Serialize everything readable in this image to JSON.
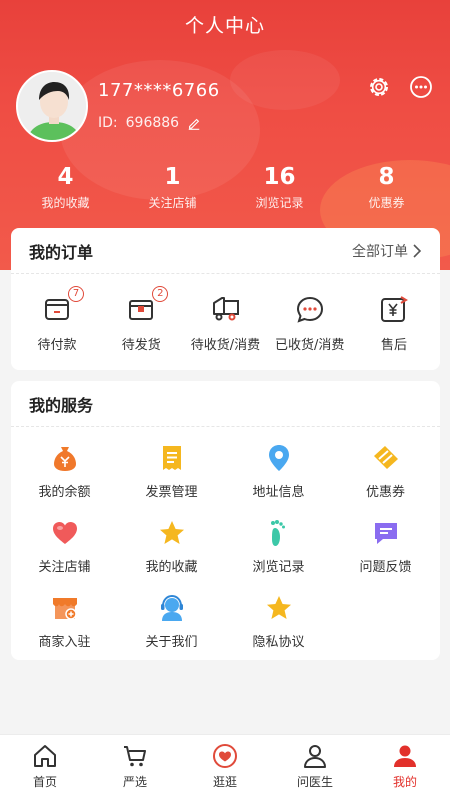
{
  "header": {
    "title": "个人中心"
  },
  "profile": {
    "phone": "177****6766",
    "id_label": "ID:",
    "id_value": "696886"
  },
  "stats": [
    {
      "value": "4",
      "label": "我的收藏"
    },
    {
      "value": "1",
      "label": "关注店铺"
    },
    {
      "value": "16",
      "label": "浏览记录"
    },
    {
      "value": "8",
      "label": "优惠券"
    }
  ],
  "orders": {
    "title": "我的订单",
    "all_link": "全部订单",
    "items": [
      {
        "label": "待付款",
        "badge": "7",
        "icon": "wallet-icon"
      },
      {
        "label": "待发货",
        "badge": "2",
        "icon": "package-icon"
      },
      {
        "label": "待收货/消费",
        "icon": "truck-icon"
      },
      {
        "label": "已收货/消费",
        "icon": "chat-dots-icon"
      },
      {
        "label": "售后",
        "icon": "yen-refund-icon"
      }
    ]
  },
  "services": {
    "title": "我的服务",
    "items": [
      {
        "label": "我的余额",
        "icon": "money-bag-icon"
      },
      {
        "label": "发票管理",
        "icon": "invoice-icon"
      },
      {
        "label": "地址信息",
        "icon": "location-pin-icon"
      },
      {
        "label": "优惠券",
        "icon": "coupon-icon"
      },
      {
        "label": "关注店铺",
        "icon": "heart-icon"
      },
      {
        "label": "我的收藏",
        "icon": "star-icon"
      },
      {
        "label": "浏览记录",
        "icon": "footprint-icon"
      },
      {
        "label": "问题反馈",
        "icon": "feedback-icon"
      },
      {
        "label": "商家入驻",
        "icon": "store-icon"
      },
      {
        "label": "关于我们",
        "icon": "headset-icon"
      },
      {
        "label": "隐私协议",
        "icon": "star-icon"
      }
    ]
  },
  "tabbar": {
    "items": [
      {
        "label": "首页",
        "icon": "home-icon"
      },
      {
        "label": "严选",
        "icon": "cart-icon"
      },
      {
        "label": "逛逛",
        "icon": "heart-chat-icon"
      },
      {
        "label": "问医生",
        "icon": "doctor-icon"
      },
      {
        "label": "我的",
        "icon": "user-icon",
        "active": true
      }
    ]
  },
  "colors": {
    "brand": "#e8413b",
    "active_tab": "#e2302b"
  }
}
